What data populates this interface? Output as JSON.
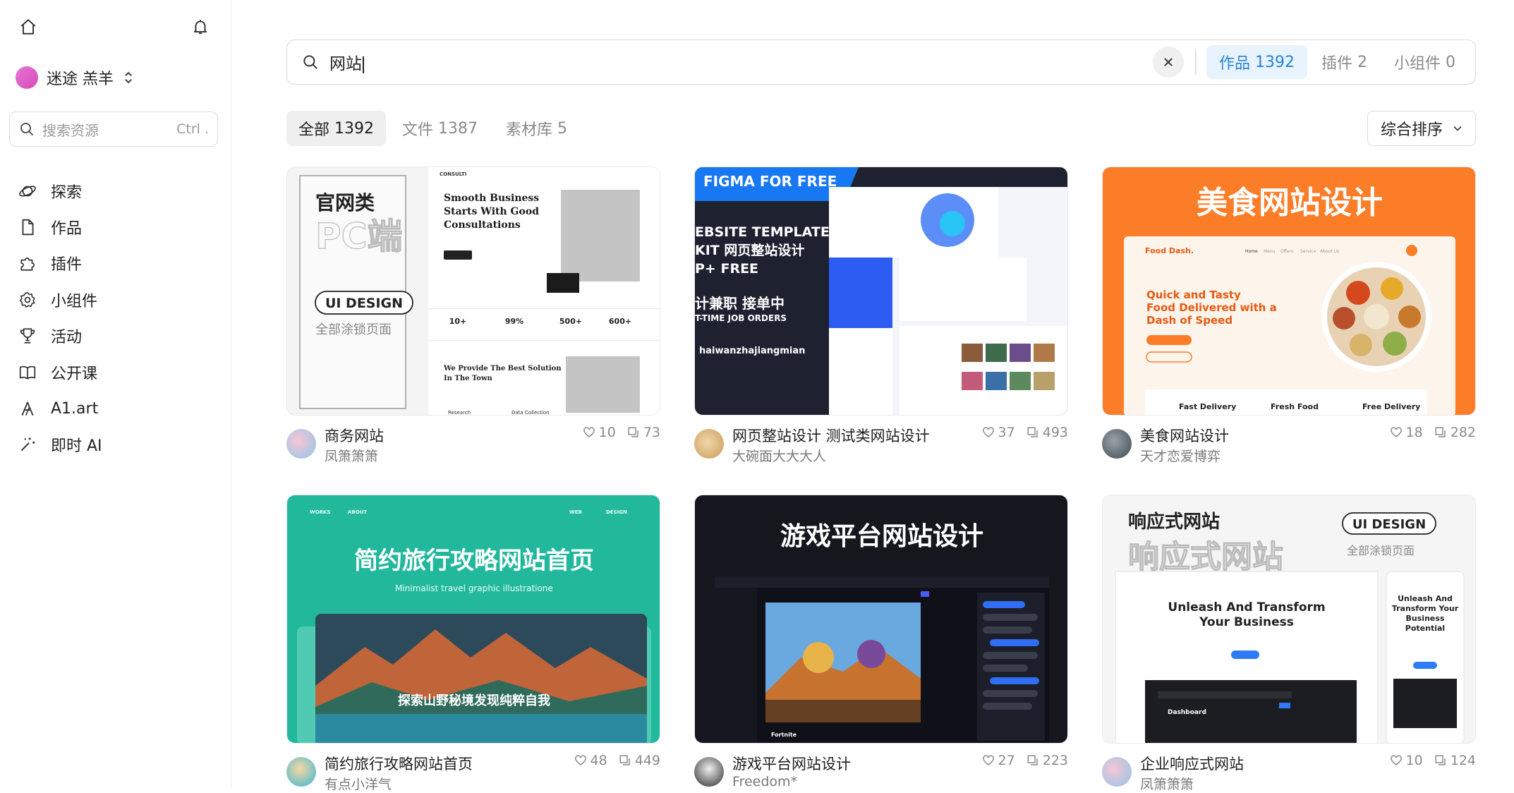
{
  "sidebar": {
    "user_name": "迷途 羔羊",
    "search": {
      "placeholder": "搜索资源",
      "shortcut": "Ctrl ."
    },
    "nav": [
      {
        "label": "探索",
        "icon": "explore-icon"
      },
      {
        "label": "作品",
        "icon": "file-icon"
      },
      {
        "label": "插件",
        "icon": "puzzle-icon"
      },
      {
        "label": "小组件",
        "icon": "widget-gear-icon"
      },
      {
        "label": "活动",
        "icon": "trophy-icon"
      },
      {
        "label": "公开课",
        "icon": "book-icon"
      },
      {
        "label": "A1.art",
        "icon": "art-icon"
      },
      {
        "label": "即时 AI",
        "icon": "magic-wand-icon"
      }
    ]
  },
  "search": {
    "query": "网站",
    "type_tabs": [
      {
        "label": "作品",
        "count": "1392",
        "active": true
      },
      {
        "label": "插件",
        "count": "2",
        "active": false
      },
      {
        "label": "小组件",
        "count": "0",
        "active": false
      }
    ]
  },
  "filters": [
    {
      "label": "全部",
      "count": "1392",
      "active": true
    },
    {
      "label": "文件",
      "count": "1387",
      "active": false
    },
    {
      "label": "素材库",
      "count": "5",
      "active": false
    }
  ],
  "sort": {
    "label": "综合排序"
  },
  "colors": {
    "accent": "#2684d6",
    "accent_bg": "#e8f3fd"
  },
  "cards": [
    {
      "title": "商务网站",
      "author": "凤箫箫箫",
      "likes": "10",
      "comments": "73",
      "thumb": {
        "big": "官网类",
        "outline": "PC端",
        "badge": "UI DESIGN",
        "sub": "全部涂锁页面",
        "brand": "CONSULTI",
        "headline": "Smooth Business Starts With Good Consultations",
        "stats": [
          "10+",
          "99%",
          "500+",
          "600+"
        ],
        "section": "We Provide The Best Solution In The Town",
        "foot": [
          "Research",
          "Data Collection"
        ]
      }
    },
    {
      "title": "网页整站设计 测试类网站设计",
      "author": "大碗面大大大人",
      "likes": "37",
      "comments": "493",
      "thumb": {
        "banner": "FIGMA FOR FREE",
        "lines": [
          "EBSITE TEMPLATE",
          "KIT 网页整站设计",
          "P+ FREE"
        ],
        "cn": "计兼职 接单中",
        "cn_sub": "T-TIME JOB ORDERS",
        "handle": "haiwanzhajiangmian"
      }
    },
    {
      "title": "美食网站设计",
      "author": "天才恋爱博弈",
      "likes": "18",
      "comments": "282",
      "thumb": {
        "big": "美食网站设计",
        "logo": "Food Dash.",
        "nav": [
          "Home",
          "Menu",
          "Offers",
          "Service",
          "About Us"
        ],
        "hero_lines": [
          "Quick and Tasty",
          "Food Delivered with a",
          "Dash of Speed"
        ],
        "features": [
          "Fast Delivery",
          "Fresh Food",
          "Free Delivery"
        ]
      }
    },
    {
      "title": "简约旅行攻略网站首页",
      "author": "有点小洋气",
      "likes": "48",
      "comments": "449",
      "thumb": {
        "nav": [
          "WORKS",
          "ABOUT",
          "WEB",
          "DESIGN"
        ],
        "big": "简约旅行攻略网站首页",
        "sub": "Minimalist travel graphic illustratione",
        "inner": "探索山野秘境发现纯粹自我"
      }
    },
    {
      "title": "游戏平台网站设计",
      "author": "Freedom*",
      "likes": "27",
      "comments": "223",
      "thumb": {
        "big": "游戏平台网站设计",
        "caption": "Fortnite"
      }
    },
    {
      "title": "企业响应式网站",
      "author": "凤箫箫箫",
      "likes": "10",
      "comments": "124",
      "thumb": {
        "big": "响应式网站",
        "outline": "响应式网站",
        "badge": "UI DESIGN",
        "sub": "全部涂锁页面",
        "headline": "Unleash And Transform Your Business Potential",
        "mobile": "Unleash And Transform Your Business Potential",
        "dash": "Dashboard"
      }
    }
  ]
}
